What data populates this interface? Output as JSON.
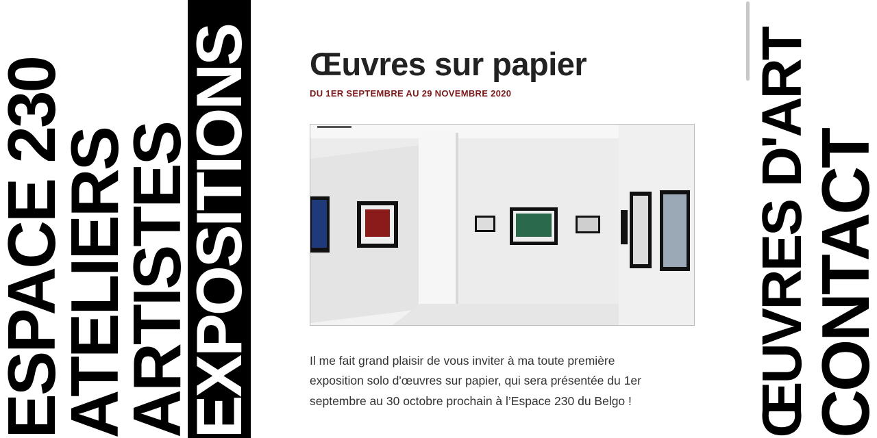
{
  "nav": {
    "items": [
      {
        "label": "ESPACE 230"
      },
      {
        "label": "ATELIERS"
      },
      {
        "label": "ARTISTES"
      },
      {
        "label": "EXPOSITIONS",
        "active": true
      },
      {
        "label": "ŒUVRES D'ART"
      },
      {
        "label": "CONTACT"
      }
    ]
  },
  "exhibition": {
    "title": "Œuvres sur papier",
    "dates": "DU 1ER SEPTEMBRE AU 29 NOVEMBRE 2020",
    "paragraph": "Il me fait grand plaisir de vous inviter à ma toute première exposition solo d'œuvres sur papier, qui sera présentée du 1er septembre au 30 octobre prochain à l’Espace 230 du Belgo !"
  },
  "colors": {
    "active_nav_bg": "#000000",
    "date_color": "#7a1a1a",
    "text": "#333333"
  }
}
